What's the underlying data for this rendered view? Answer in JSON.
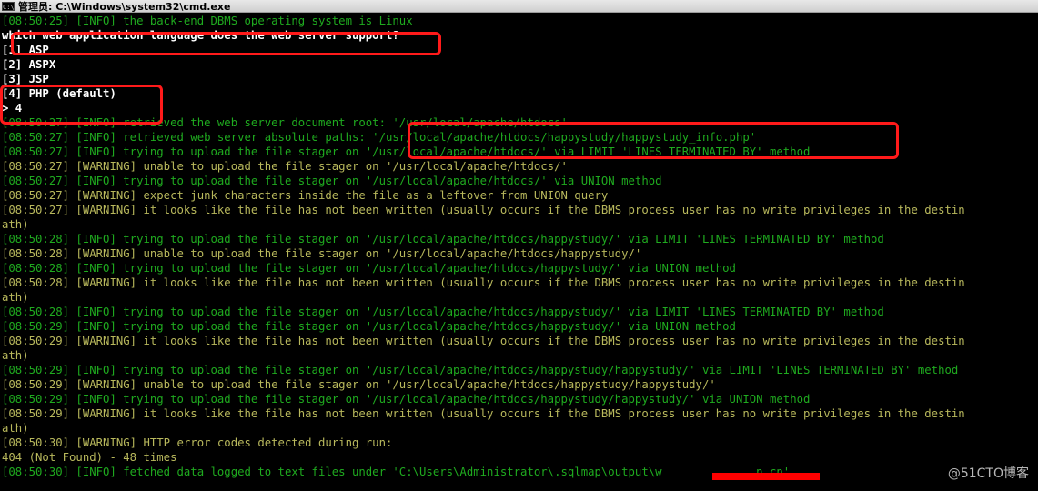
{
  "window": {
    "title": "管理员: C:\\Windows\\system32\\cmd.exe",
    "icon": "cmd-icon"
  },
  "lines": [
    {
      "text": "[08:50:25] [INFO] the back-end DBMS operating system is Linux",
      "color": "green"
    },
    {
      "text": "which web application language does the web server support?",
      "color": "white"
    },
    {
      "text": "[1] ASP",
      "color": "white"
    },
    {
      "text": "[2] ASPX",
      "color": "white"
    },
    {
      "text": "[3] JSP",
      "color": "white"
    },
    {
      "text": "[4] PHP (default)",
      "color": "white"
    },
    {
      "text": "> 4",
      "color": "white"
    },
    {
      "text": "[08:50:27] [INFO] retrieved the web server document root: '/usr/local/apache/htdocs'",
      "color": "green"
    },
    {
      "text": "[08:50:27] [INFO] retrieved web server absolute paths: '/usr/local/apache/htdocs/happystudy/happystudy_info.php'",
      "color": "green"
    },
    {
      "text": "[08:50:27] [INFO] trying to upload the file stager on '/usr/local/apache/htdocs/' via LIMIT 'LINES TERMINATED BY' method",
      "color": "green"
    },
    {
      "text": "[08:50:27] [WARNING] unable to upload the file stager on '/usr/local/apache/htdocs/'",
      "color": "olive"
    },
    {
      "text": "[08:50:27] [INFO] trying to upload the file stager on '/usr/local/apache/htdocs/' via UNION method",
      "color": "green"
    },
    {
      "text": "[08:50:27] [WARNING] expect junk characters inside the file as a leftover from UNION query",
      "color": "olive"
    },
    {
      "text": "[08:50:27] [WARNING] it looks like the file has not been written (usually occurs if the DBMS process user has no write privileges in the destin",
      "color": "olive"
    },
    {
      "text": "ath)",
      "color": "olive"
    },
    {
      "text": "[08:50:28] [INFO] trying to upload the file stager on '/usr/local/apache/htdocs/happystudy/' via LIMIT 'LINES TERMINATED BY' method",
      "color": "green"
    },
    {
      "text": "[08:50:28] [WARNING] unable to upload the file stager on '/usr/local/apache/htdocs/happystudy/'",
      "color": "olive"
    },
    {
      "text": "[08:50:28] [INFO] trying to upload the file stager on '/usr/local/apache/htdocs/happystudy/' via UNION method",
      "color": "green"
    },
    {
      "text": "[08:50:28] [WARNING] it looks like the file has not been written (usually occurs if the DBMS process user has no write privileges in the destin",
      "color": "olive"
    },
    {
      "text": "ath)",
      "color": "olive"
    },
    {
      "text": "[08:50:28] [INFO] trying to upload the file stager on '/usr/local/apache/htdocs/happystudy/' via LIMIT 'LINES TERMINATED BY' method",
      "color": "green"
    },
    {
      "text": "[08:50:29] [INFO] trying to upload the file stager on '/usr/local/apache/htdocs/happystudy/' via UNION method",
      "color": "green"
    },
    {
      "text": "[08:50:29] [WARNING] it looks like the file has not been written (usually occurs if the DBMS process user has no write privileges in the destin",
      "color": "olive"
    },
    {
      "text": "ath)",
      "color": "olive"
    },
    {
      "text": "[08:50:29] [INFO] trying to upload the file stager on '/usr/local/apache/htdocs/happystudy/happystudy/' via LIMIT 'LINES TERMINATED BY' method",
      "color": "green"
    },
    {
      "text": "[08:50:29] [WARNING] unable to upload the file stager on '/usr/local/apache/htdocs/happystudy/happystudy/'",
      "color": "olive"
    },
    {
      "text": "[08:50:29] [INFO] trying to upload the file stager on '/usr/local/apache/htdocs/happystudy/happystudy/' via UNION method",
      "color": "green"
    },
    {
      "text": "[08:50:29] [WARNING] it looks like the file has not been written (usually occurs if the DBMS process user has no write privileges in the destin",
      "color": "olive"
    },
    {
      "text": "ath)",
      "color": "olive"
    },
    {
      "text": "[08:50:30] [WARNING] HTTP error codes detected during run:",
      "color": "olive"
    },
    {
      "text": "404 (Not Found) - 48 times",
      "color": "olive"
    },
    {
      "text": "[08:50:30] [INFO] fetched data logged to text files under 'C:\\Users\\Administrator\\.sqlmap\\output\\w              n.cn'",
      "color": "green"
    }
  ],
  "highlight_color": "#ff1a1a",
  "redaction_color": "#ff0000",
  "watermark": "@51CTO博客"
}
